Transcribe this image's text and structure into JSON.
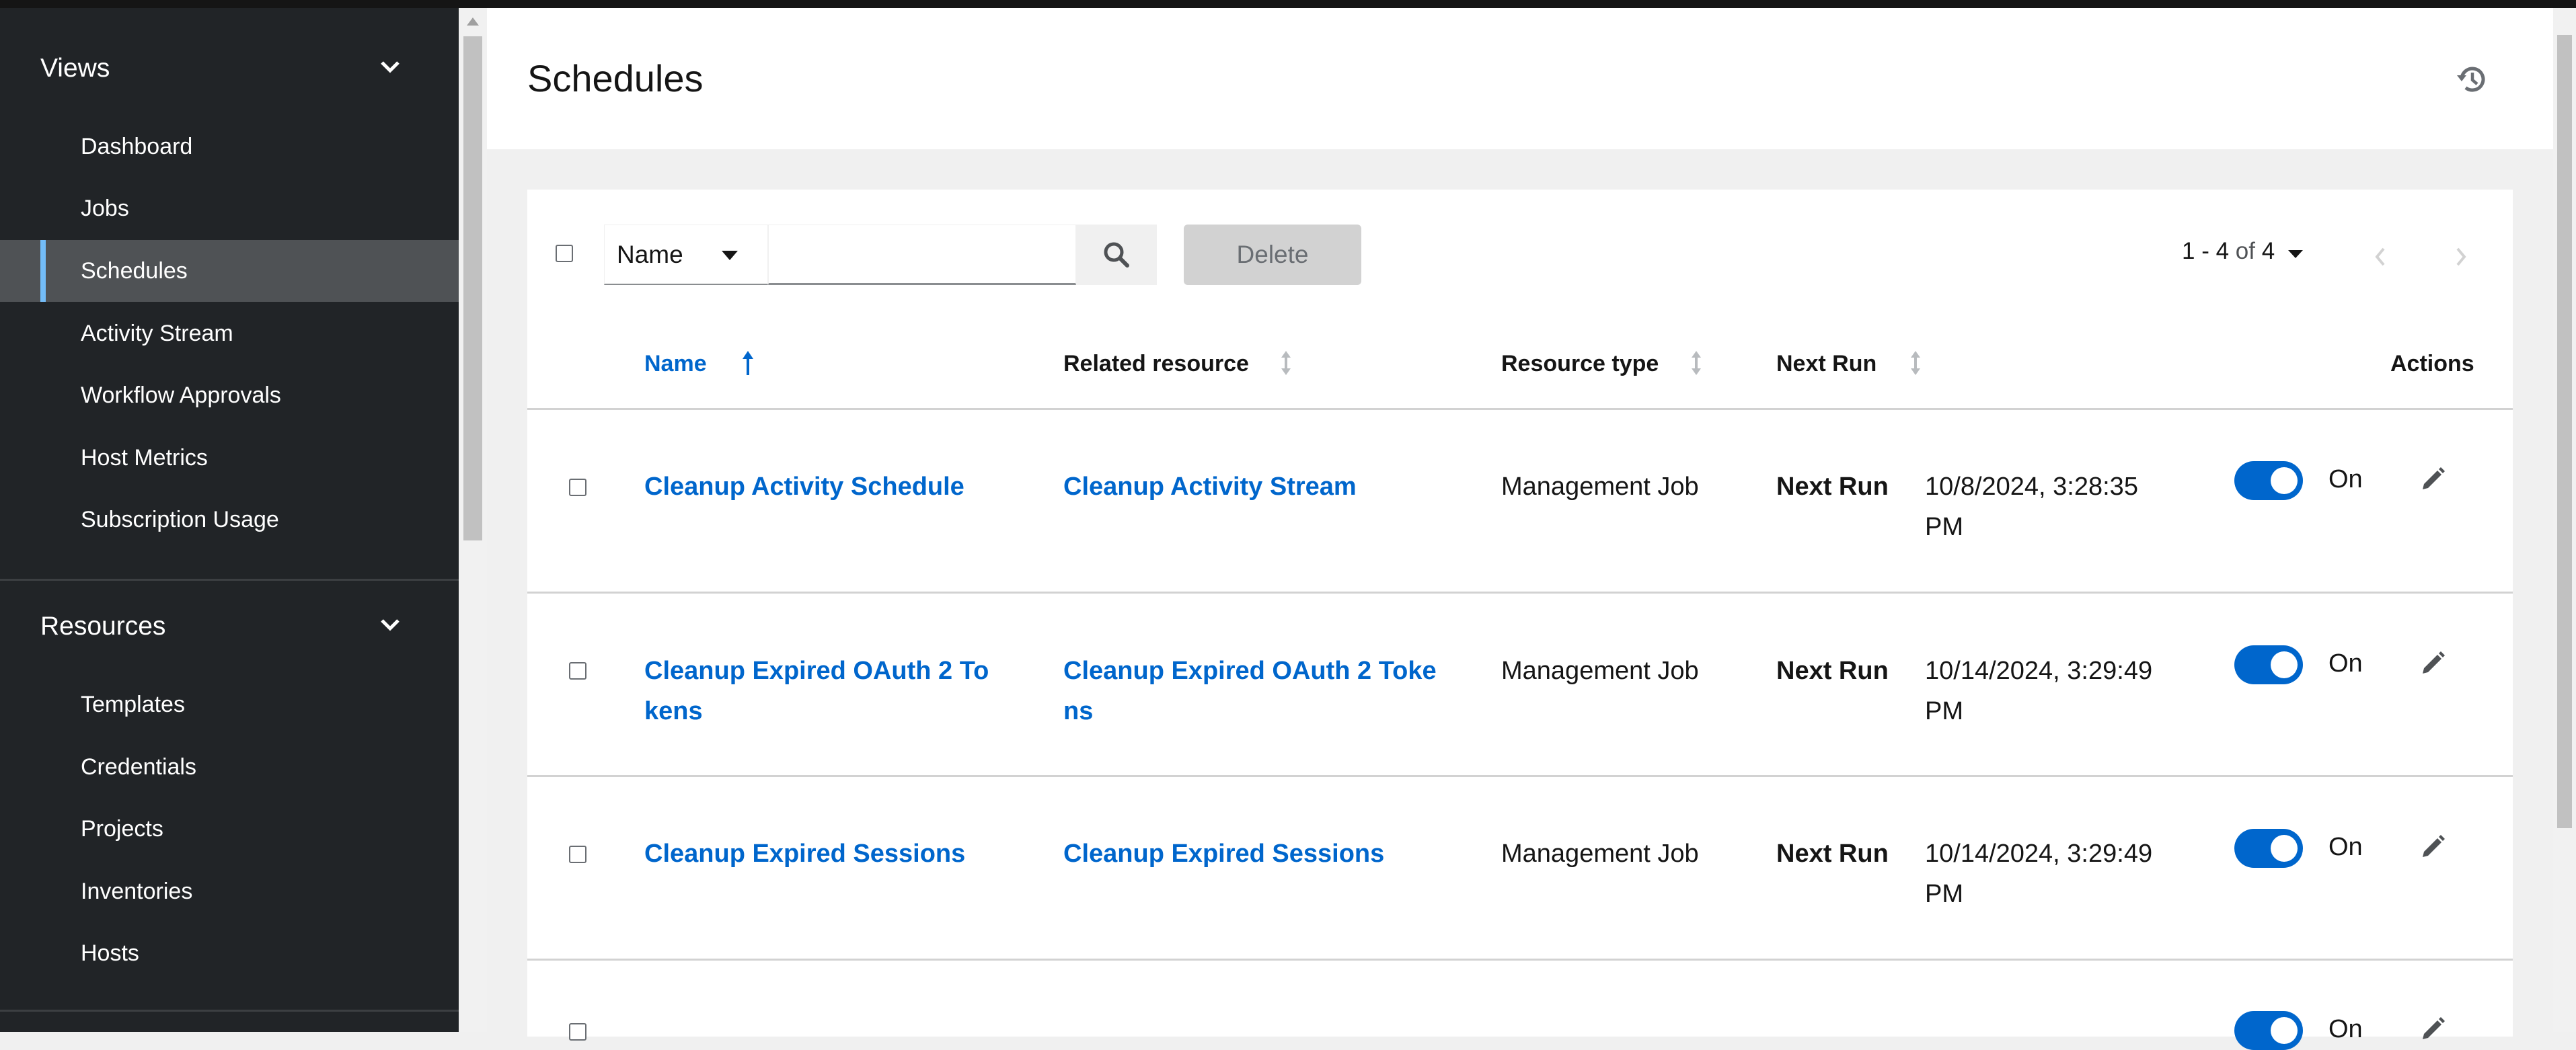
{
  "sidebar": {
    "groups": [
      {
        "label": "Views",
        "items": [
          "Dashboard",
          "Jobs",
          "Schedules",
          "Activity Stream",
          "Workflow Approvals",
          "Host Metrics",
          "Subscription Usage"
        ]
      },
      {
        "label": "Resources",
        "items": [
          "Templates",
          "Credentials",
          "Projects",
          "Inventories",
          "Hosts"
        ]
      }
    ],
    "active_item": "Schedules"
  },
  "header": {
    "title": "Schedules",
    "history_icon": "history-icon"
  },
  "toolbar": {
    "filter_select": "Name",
    "search_placeholder": "",
    "search_icon": "search-icon",
    "delete_label": "Delete",
    "pagination": {
      "range": "1 - 4",
      "of_label": "of",
      "total": "4"
    }
  },
  "table": {
    "columns": [
      "Name",
      "Related resource",
      "Resource type",
      "Next Run",
      "Actions"
    ],
    "sorted_column": "Name",
    "rows": [
      {
        "name_line1": "Cleanup Activity Schedule",
        "name_line2": "",
        "related_line1": "Cleanup Activity Stream",
        "related_line2": "",
        "type": "Management Job",
        "next_run_label": "Next Run",
        "next_run_line1": "10/8/2024, 3:28:35",
        "next_run_line2": "PM",
        "toggle": "On"
      },
      {
        "name_line1": "Cleanup Expired OAuth 2 To",
        "name_line2": "kens",
        "related_line1": "Cleanup Expired OAuth 2 Toke",
        "related_line2": "ns",
        "type": "Management Job",
        "next_run_label": "Next Run",
        "next_run_line1": "10/14/2024, 3:29:49",
        "next_run_line2": "PM",
        "toggle": "On"
      },
      {
        "name_line1": "Cleanup Expired Sessions",
        "name_line2": "",
        "related_line1": "Cleanup Expired Sessions",
        "related_line2": "",
        "type": "Management Job",
        "next_run_label": "Next Run",
        "next_run_line1": "10/14/2024, 3:29:49",
        "next_run_line2": "PM",
        "toggle": "On"
      },
      {
        "toggle": "On"
      }
    ]
  },
  "colors": {
    "sidebar_bg": "#212427",
    "active_item_bg": "#4f5255",
    "active_indicator": "#73bcf7",
    "link": "#0066cc",
    "toggle_on": "#0066cc"
  }
}
